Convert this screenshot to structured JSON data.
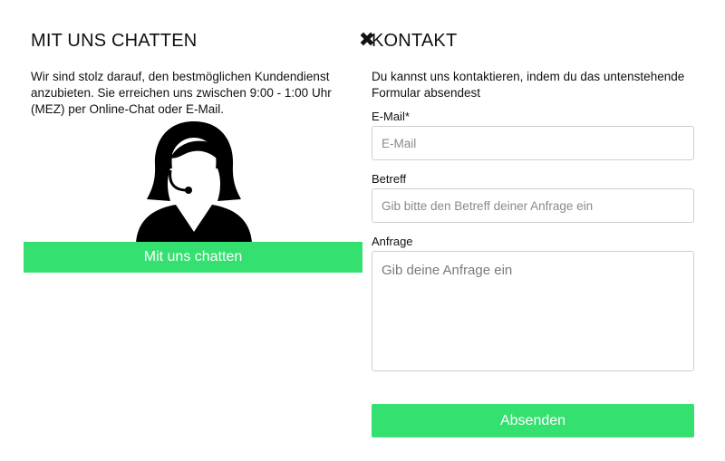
{
  "chat": {
    "title": "MIT UNS CHATTEN",
    "intro": "Wir sind stolz darauf, den bestmöglichen Kundendienst anzubieten. Sie erreichen uns zwischen 9:00 - 1:00 Uhr (MEZ) per Online-Chat oder E-Mail.",
    "button_label": "Mit uns chatten",
    "close_icon": "✖"
  },
  "contact": {
    "title": "KONTAKT",
    "intro": "Du kannst uns kontaktieren, indem du das untenstehende Formular absendest",
    "email": {
      "label": "E-Mail*",
      "placeholder": "E-Mail",
      "value": ""
    },
    "subject": {
      "label": "Betreff",
      "placeholder": "Gib bitte den Betreff deiner Anfrage ein",
      "value": ""
    },
    "message": {
      "label": "Anfrage",
      "placeholder": "Gib deine Anfrage ein",
      "value": ""
    },
    "submit_label": "Absenden"
  },
  "colors": {
    "accent": "#34e06f",
    "text": "#111111",
    "border": "#cfcfcf"
  },
  "icons": {
    "close": "close-icon",
    "avatar": "support-agent-avatar"
  }
}
